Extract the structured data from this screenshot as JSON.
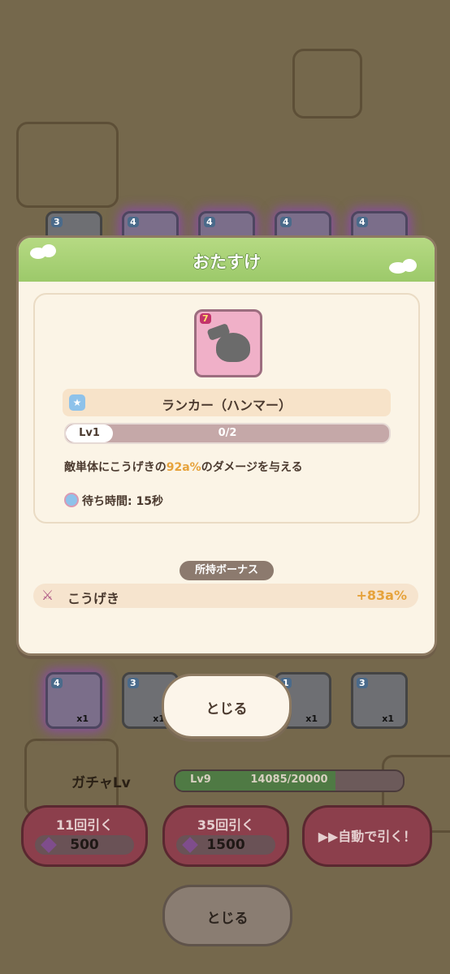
{
  "background": {
    "top_cards": [
      {
        "stars": "3"
      },
      {
        "stars": "4"
      },
      {
        "stars": "4"
      },
      {
        "stars": "4"
      },
      {
        "stars": "4"
      }
    ],
    "bottom_cards": [
      {
        "stars": "4",
        "count": "x1"
      },
      {
        "stars": "3",
        "count": "x1"
      },
      {
        "stars": "1",
        "count": "x1"
      },
      {
        "stars": "3",
        "count": "x1"
      }
    ],
    "gacha_label": "ガチャLv",
    "gacha_level": "Lv9",
    "gacha_progress_text": "14085/20000",
    "gacha_progress_fraction": 0.704,
    "pull_buttons": [
      {
        "label": "11回引く",
        "cost": "500"
      },
      {
        "label": "35回引く",
        "cost": "1500"
      },
      {
        "label": "▶▶自動で引く！"
      }
    ],
    "bottom_close": "とじる"
  },
  "dialog": {
    "title": "おたすけ",
    "unit": {
      "stars": "7",
      "name": "ランカー（ハンマー）",
      "level": "Lv1",
      "progress": "0/2",
      "progress_fraction": 0
    },
    "description_pre": "敵単体にこうげきの",
    "description_highlight": "92a%",
    "description_post": "のダメージを与える",
    "wait_time": "待ち時間: 15秒",
    "bonus_header": "所持ボーナス",
    "bonus": {
      "label": "こうげき",
      "value": "+83a%"
    },
    "close": "とじる"
  },
  "colors": {
    "accent_green": "#9cc96a",
    "highlight_orange": "#e6a23a",
    "text_brown": "#4b3a2f"
  }
}
